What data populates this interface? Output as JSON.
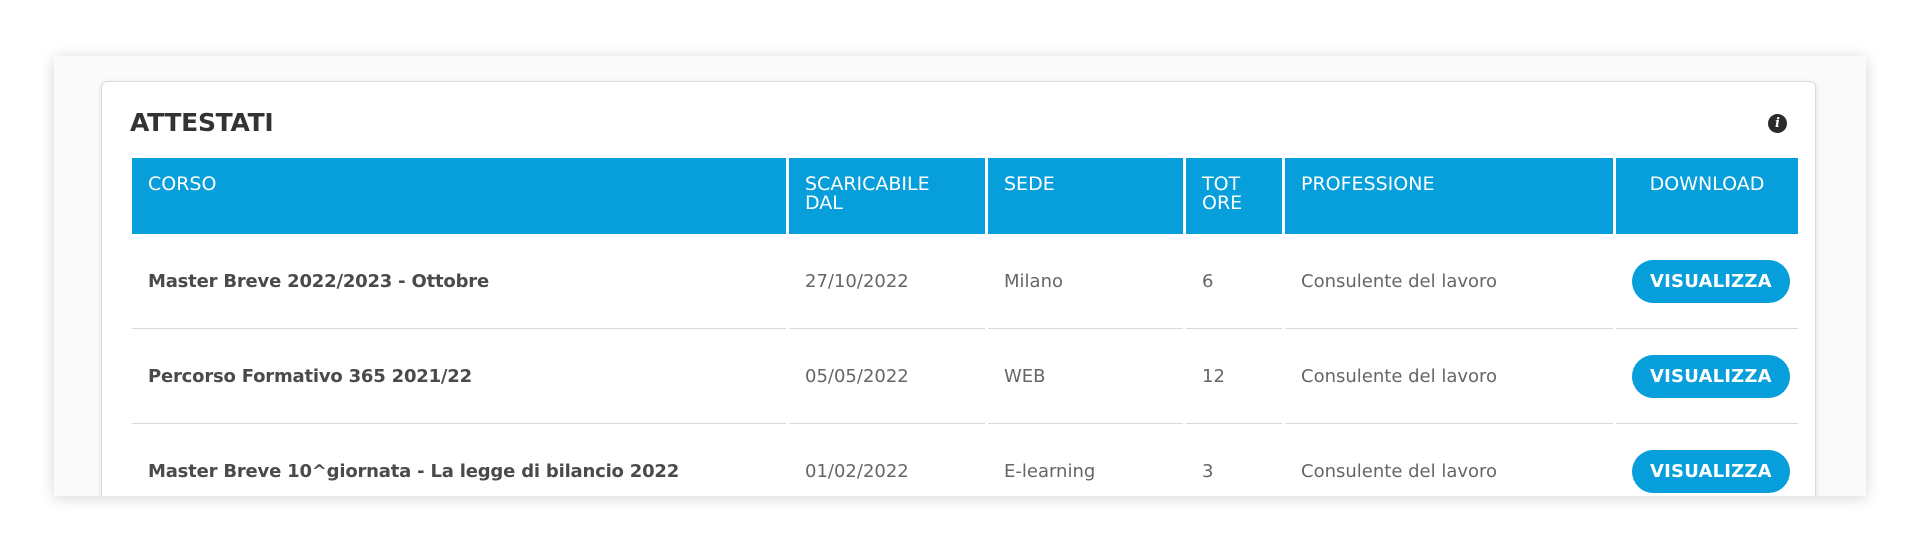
{
  "panel": {
    "title": "ATTESTATI",
    "info_icon": "info-circle-icon"
  },
  "table": {
    "headers": {
      "corso": "CORSO",
      "scaricabile": "SCARICABILE DAL",
      "sede": "SEDE",
      "ore": "TOT ORE",
      "professione": "PROFESSIONE",
      "download": "DOWNLOAD"
    },
    "rows": [
      {
        "corso": "Master Breve 2022/2023 - Ottobre",
        "scaricabile": "27/10/2022",
        "sede": "Milano",
        "ore": "6",
        "professione": "Consulente del lavoro",
        "action": "VISUALIZZA"
      },
      {
        "corso": "Percorso Formativo 365 2021/22",
        "scaricabile": "05/05/2022",
        "sede": "WEB",
        "ore": "12",
        "professione": "Consulente del lavoro",
        "action": "VISUALIZZA"
      },
      {
        "corso": "Master Breve 10^giornata - La legge di bilancio 2022",
        "scaricabile": "01/02/2022",
        "sede": "E-learning",
        "ore": "3",
        "professione": "Consulente del lavoro",
        "action": "VISUALIZZA"
      }
    ]
  },
  "colors": {
    "header_bg": "#069edb",
    "button_bg": "#069edb",
    "title_text": "#333333"
  }
}
